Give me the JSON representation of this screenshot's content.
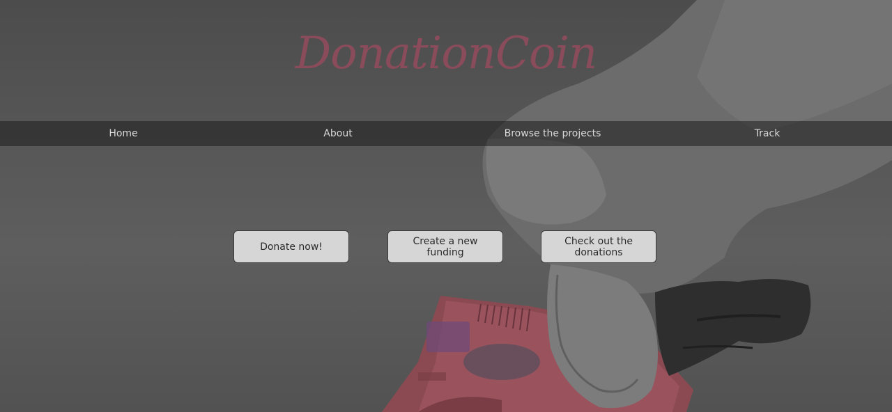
{
  "brand": {
    "title": "DonationCoin",
    "color": "#8a4b5b"
  },
  "nav": {
    "items": [
      {
        "label": "Home"
      },
      {
        "label": "About"
      },
      {
        "label": "Browse the projects"
      },
      {
        "label": "Track"
      }
    ]
  },
  "actions": {
    "donate_label": "Donate now!",
    "create_label": "Create a new funding",
    "check_label": "Check out the donations"
  },
  "hero": {
    "description": "gloved-hand-holding-banknote"
  }
}
